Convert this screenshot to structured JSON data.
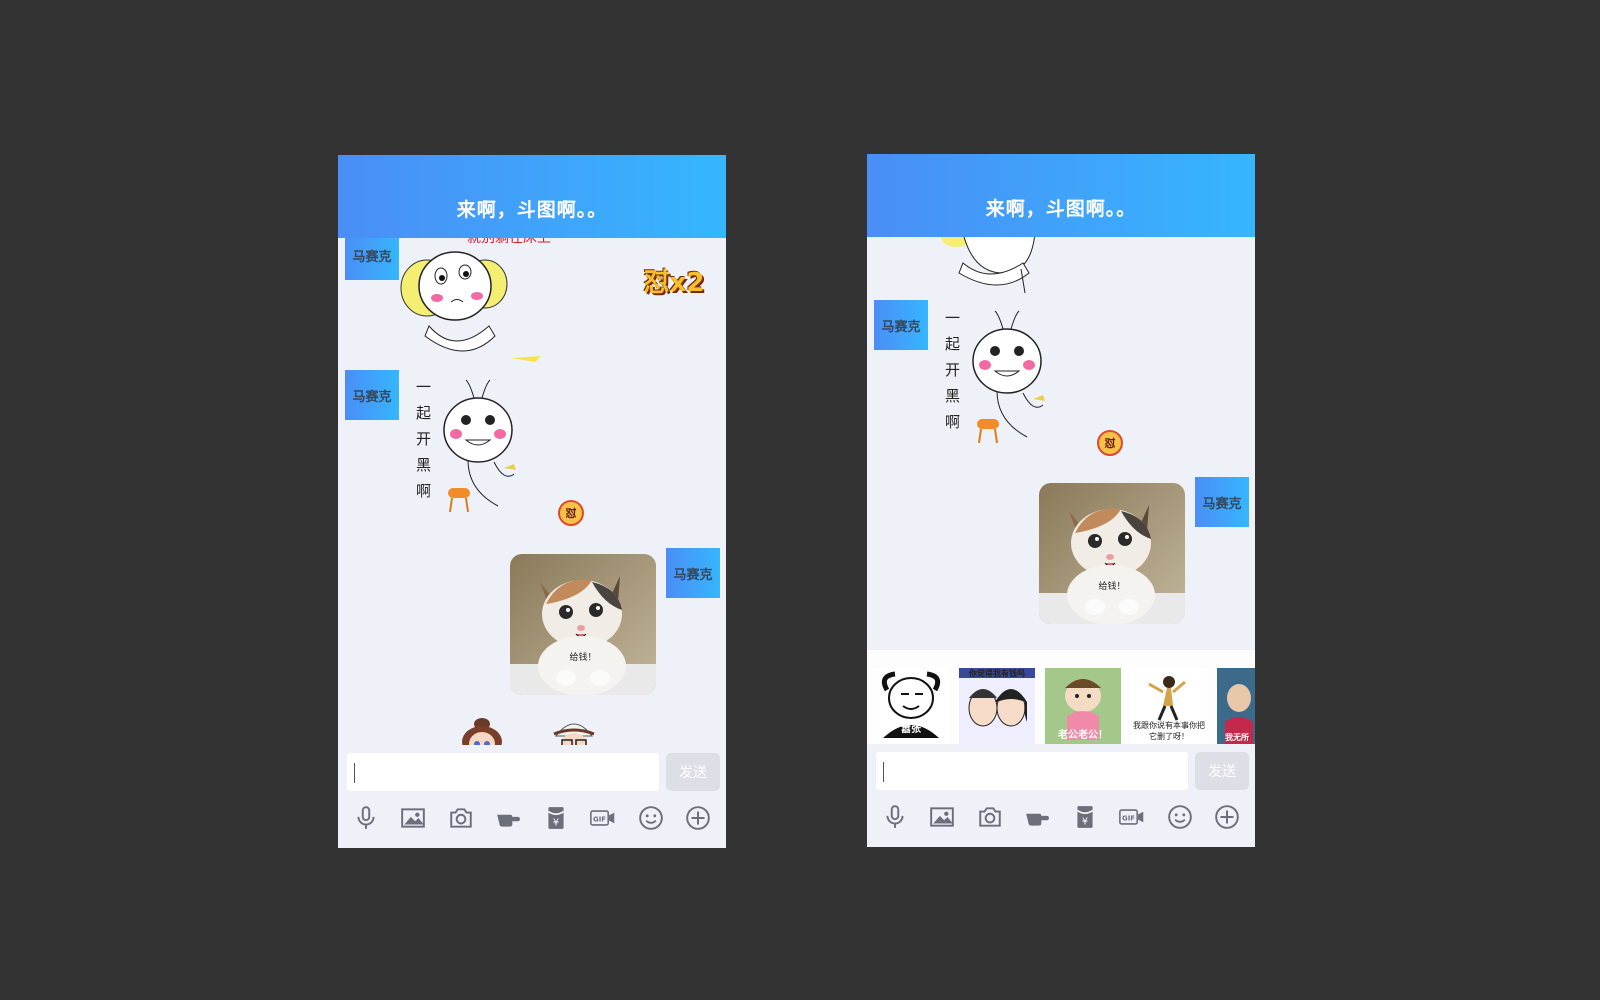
{
  "colors": {
    "background": "#333333",
    "header_start": "#4a8ef6",
    "header_end": "#36b6fe",
    "chat_bg": "#eef1f8",
    "send_disabled": "#dcdfe6"
  },
  "left_phone": {
    "header": {
      "title": "来啊，斗图啊。。"
    },
    "messages": [
      {
        "sender": "马赛克",
        "side": "left",
        "sticker_text": "就别躺在床上"
      },
      {
        "sender": "马赛克",
        "side": "left",
        "sticker_text": "一起开黑啊"
      },
      {
        "sender": "马赛克",
        "side": "right",
        "caption": "给钱！"
      }
    ],
    "extra_badge": "怼x2",
    "badge_small": "怼",
    "input": {
      "value": "",
      "placeholder": ""
    },
    "send_label": "发送"
  },
  "right_phone": {
    "header": {
      "title": "来啊，斗图啊。。"
    },
    "messages": [
      {
        "sender": "马赛克",
        "side": "left",
        "sticker_text": "一起开黑啊"
      },
      {
        "sender": "马赛克",
        "side": "right",
        "caption": "给钱！"
      }
    ],
    "badge_small": "怼",
    "tray": [
      {
        "caption": "嚣张"
      },
      {
        "caption": "你觉得我有钱吗"
      },
      {
        "caption": "老公老公！"
      },
      {
        "caption": "我跟你说有本事你把它删了呀！"
      },
      {
        "caption": "我无所"
      }
    ],
    "input": {
      "value": "",
      "placeholder": ""
    },
    "send_label": "发送"
  },
  "toolbar_icons": [
    "microphone-icon",
    "image-icon",
    "camera-icon",
    "pointing-hand-icon",
    "red-packet-icon",
    "gif-icon",
    "emoji-icon",
    "plus-icon"
  ]
}
